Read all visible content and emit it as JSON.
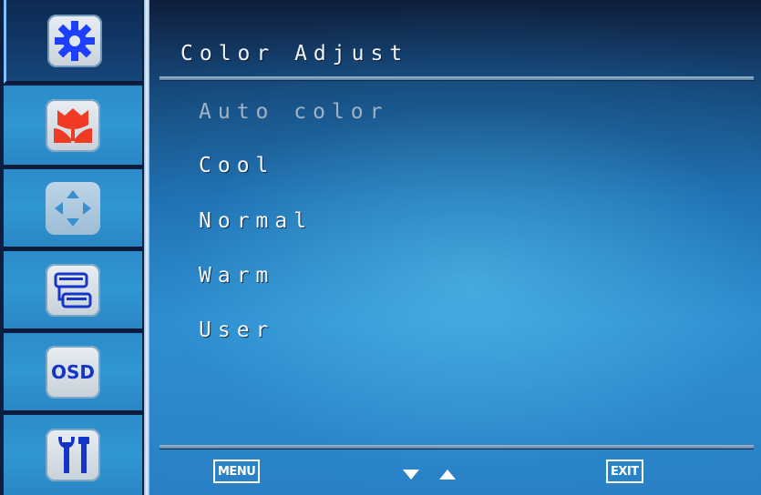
{
  "osd": {
    "title": "Color Adjust",
    "sidebar": [
      {
        "name": "settings",
        "icon": "gear-icon",
        "active": true
      },
      {
        "name": "picture",
        "icon": "tulip-icon"
      },
      {
        "name": "position",
        "icon": "move-arrows-icon"
      },
      {
        "name": "input",
        "icon": "connector-icon"
      },
      {
        "name": "osd",
        "icon": "osd-icon",
        "label": "OSD"
      },
      {
        "name": "tools",
        "icon": "tools-icon"
      }
    ],
    "menu_items": [
      {
        "label": "Auto color",
        "state": "disabled"
      },
      {
        "label": "Cool"
      },
      {
        "label": "Normal"
      },
      {
        "label": "Warm"
      },
      {
        "label": "User"
      }
    ],
    "hints": {
      "menu": "MENU",
      "navigate": "down-up-arrows-icon",
      "exit": "EXIT"
    },
    "colors": {
      "accent_blue": "#2f8fd0",
      "gear_blue": "#1d3fff",
      "tulip_red": "#f03a24"
    }
  }
}
